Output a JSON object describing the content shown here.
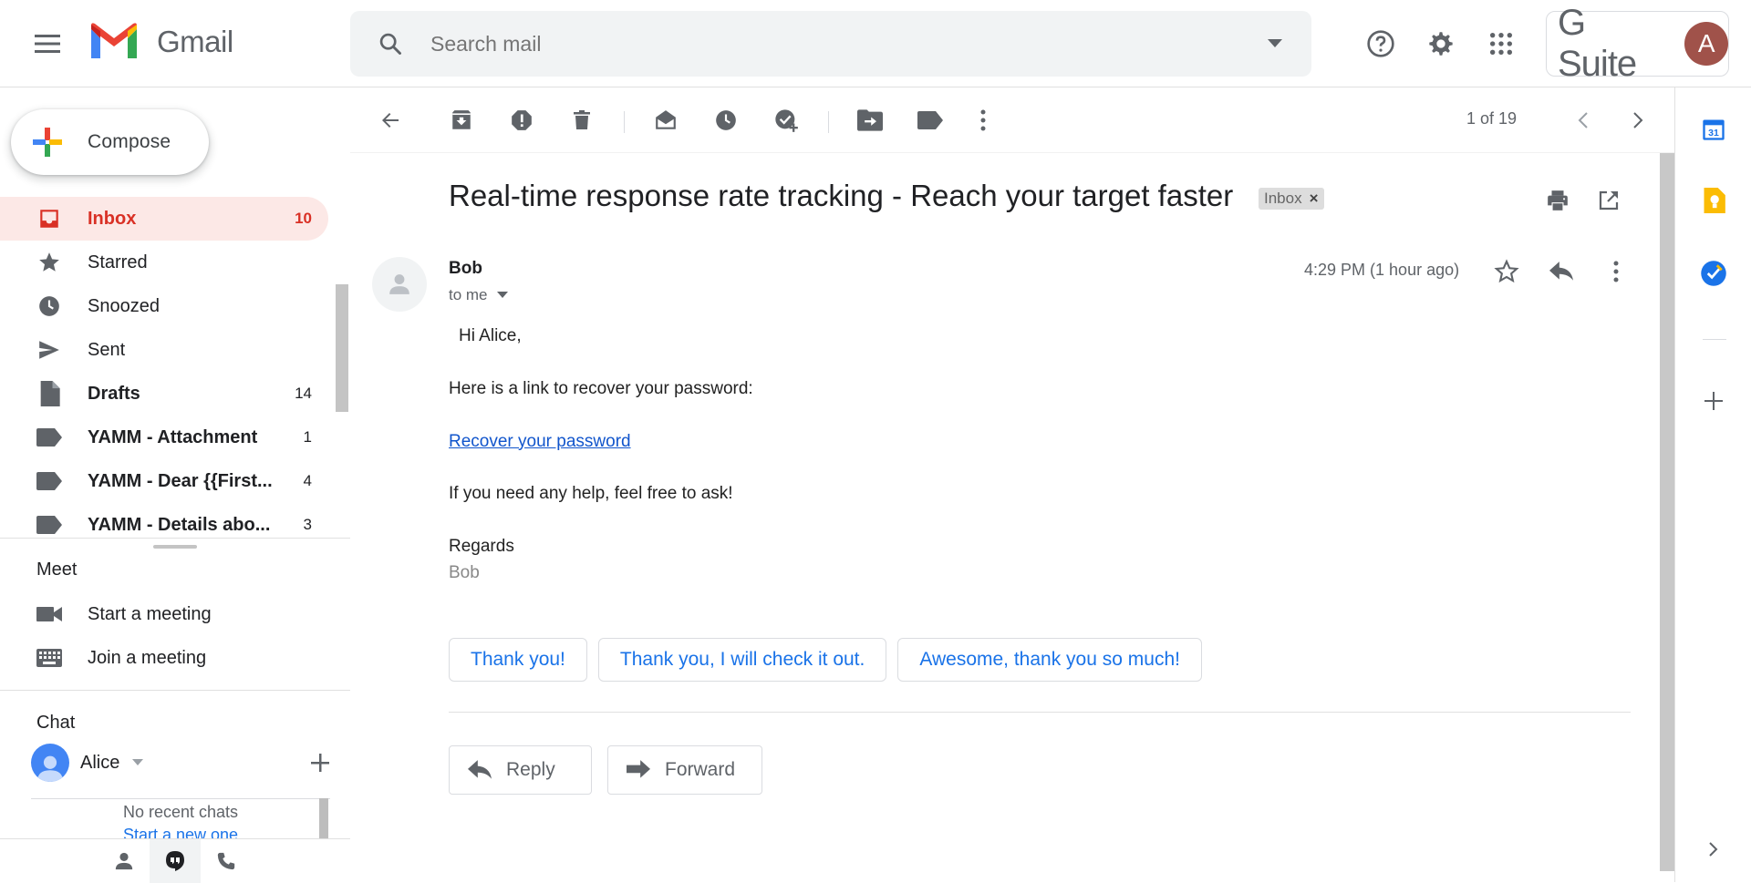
{
  "app": {
    "name": "Gmail",
    "brand_colors": {
      "red": "#d93025",
      "blue": "#1a73e8",
      "yellow": "#fbbc04",
      "green": "#34a853"
    }
  },
  "header": {
    "search_placeholder": "Search mail",
    "gsuite_label": "G Suite",
    "avatar_letter": "A",
    "icons": [
      "menu-icon",
      "search-icon",
      "caret-down-icon",
      "help-icon",
      "settings-icon",
      "apps-grid-icon"
    ]
  },
  "sidebar": {
    "compose_label": "Compose",
    "items": [
      {
        "label": "Inbox",
        "count": "10",
        "icon": "inbox-icon",
        "active": true
      },
      {
        "label": "Starred",
        "count": "",
        "icon": "star-icon"
      },
      {
        "label": "Snoozed",
        "count": "",
        "icon": "clock-icon"
      },
      {
        "label": "Sent",
        "count": "",
        "icon": "send-icon"
      },
      {
        "label": "Drafts",
        "count": "14",
        "icon": "draft-icon"
      },
      {
        "label": "YAMM - Attachment",
        "count": "1",
        "icon": "label-icon"
      },
      {
        "label": "YAMM - Dear {{First...",
        "count": "4",
        "icon": "label-icon"
      },
      {
        "label": "YAMM - Details abo...",
        "count": "3",
        "icon": "label-icon"
      }
    ],
    "meet": {
      "title": "Meet",
      "items": [
        {
          "label": "Start a meeting",
          "icon": "video-camera-icon"
        },
        {
          "label": "Join a meeting",
          "icon": "keyboard-icon"
        }
      ]
    },
    "chat": {
      "title": "Chat",
      "user": "Alice",
      "no_recent": "No recent chats",
      "start_new": "Start a new one"
    }
  },
  "toolbar": {
    "pager_text": "1 of 19",
    "icons": [
      "back-arrow-icon",
      "archive-icon",
      "report-spam-icon",
      "delete-icon",
      "mark-unread-icon",
      "snooze-icon",
      "add-to-tasks-icon",
      "move-to-icon",
      "labels-icon",
      "more-vert-icon",
      "chevron-left-icon",
      "chevron-right-icon"
    ]
  },
  "email": {
    "subject": "Real-time response rate tracking - Reach your target faster",
    "label_chip": "Inbox",
    "sender": "Bob",
    "recipient_line": "to me",
    "time": "4:29 PM (1 hour ago)",
    "body": {
      "greeting": "Hi Alice,",
      "line1": "Here is a link to recover your password:",
      "link": "Recover your password",
      "line2": "If you need any help, feel free to ask!",
      "closing": "Regards",
      "signature": "Bob"
    },
    "smart_replies": [
      "Thank you!",
      "Thank you, I will check it out.",
      "Awesome, thank you so much!"
    ],
    "reply_label": "Reply",
    "forward_label": "Forward"
  },
  "rightbar": {
    "calendar_day": "31",
    "icons": [
      "calendar-icon",
      "keep-icon",
      "tasks-icon",
      "add-addon-icon",
      "expand-panel-icon"
    ]
  }
}
